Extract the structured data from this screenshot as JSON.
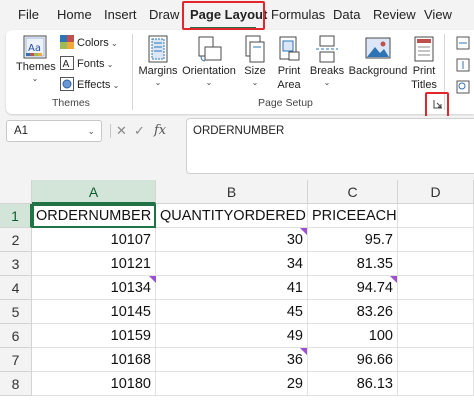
{
  "tabs": [
    {
      "label": "File"
    },
    {
      "label": "Home"
    },
    {
      "label": "Insert"
    },
    {
      "label": "Draw"
    },
    {
      "label": "Page Layout",
      "active": true
    },
    {
      "label": "Formulas"
    },
    {
      "label": "Data"
    },
    {
      "label": "Review"
    },
    {
      "label": "View"
    }
  ],
  "ribbon": {
    "themes": {
      "themes_label": "Themes",
      "colors_label": "Colors",
      "fonts_label": "Fonts",
      "effects_label": "Effects",
      "group_label": "Themes"
    },
    "page_setup": {
      "margins_label": "Margins",
      "orientation_label": "Orientation",
      "size_label": "Size",
      "print_area_label_1": "Print",
      "print_area_label_2": "Area",
      "breaks_label": "Breaks",
      "background_label": "Background",
      "print_titles_label_1": "Print",
      "print_titles_label_2": "Titles",
      "group_label": "Page Setup"
    }
  },
  "formula_bar": {
    "name_box": "A1",
    "fx_label": "fx",
    "content": "ORDERNUMBER"
  },
  "sheet": {
    "columns": [
      "A",
      "B",
      "C",
      "D"
    ],
    "rows": [
      "1",
      "2",
      "3",
      "4",
      "5",
      "6",
      "7",
      "8"
    ],
    "header_row": [
      "ORDERNUMBER",
      "QUANTITYORDERED",
      "PRICEEACH"
    ],
    "data": [
      [
        "10107",
        "30",
        "95.7"
      ],
      [
        "10121",
        "34",
        "81.35"
      ],
      [
        "10134",
        "41",
        "94.74"
      ],
      [
        "10145",
        "45",
        "83.26"
      ],
      [
        "10159",
        "49",
        "100"
      ],
      [
        "10168",
        "36",
        "96.66"
      ],
      [
        "10180",
        "29",
        "86.13"
      ]
    ]
  },
  "colors": {
    "accent": "#217346",
    "highlight_box": "#e3262b",
    "comment_marker": "#9b4fd1"
  }
}
